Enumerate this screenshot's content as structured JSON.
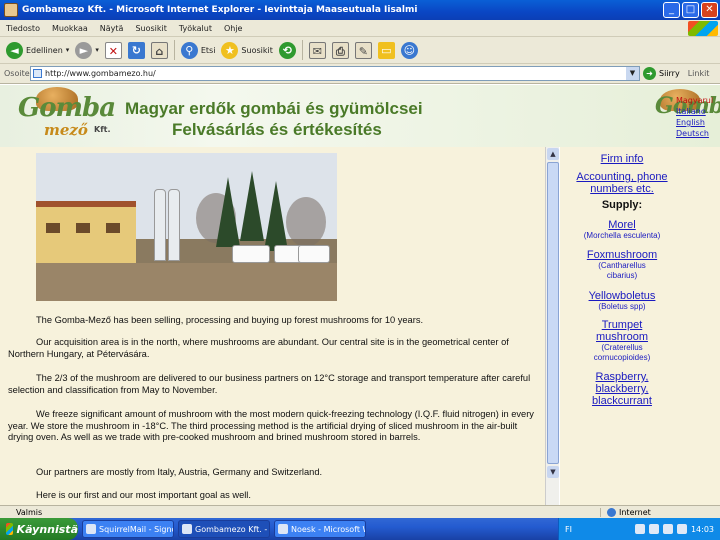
{
  "window": {
    "title": "Gombamezo Kft. - Microsoft Internet Explorer - Ievinttaja Maaseutuala Iisalmi"
  },
  "menu": [
    "Tiedosto",
    "Muokkaa",
    "Näytä",
    "Suosikit",
    "Työkalut",
    "Ohje"
  ],
  "toolbar": {
    "back_label": "Edellinen",
    "search_label": "Etsi",
    "favorites_label": "Suosikit"
  },
  "address": {
    "label": "Osoite",
    "url": "http://www.gombamezo.hu/",
    "go_label": "Siirry",
    "links_label": "Linkit"
  },
  "banner": {
    "logo_main": "Gomba",
    "logo_sub": "mező",
    "logo_kft": "Kft.",
    "title_line1": "Magyar erdők gombái és gyümölcsei",
    "title_line2": "Felvásárlás és értékesítés",
    "languages": [
      "Magyarul",
      "Italiano",
      "English",
      "Deutsch"
    ]
  },
  "content": {
    "paragraphs": [
      "The Gomba-Mező has been selling, processing and buying up forest mushrooms for 10 years.",
      "Our acquisition area is in the north, where mushrooms are abundant. Our central site is in the geometrical center of Northern Hungary, at Pétervására.",
      "The 2/3 of the mushroom are delivered to our business partners on 12°C storage and transport temperature after careful selection and classification from May to November.",
      "We freeze significant amount of mushroom with the most modern quick-freezing technology (I.Q.F. fluid nitrogen) in every year. We store the mushroom in -18°C. The third processing method is the artificial drying of sliced mushroom in the air-built drying oven. As well as we trade with pre-cooked mushroom and brined mushroom stored in barrels.",
      "Our partners are mostly from Italy, Austria, Germany and Switzerland.",
      "Here is our first and our most important goal as well."
    ]
  },
  "sidebar": {
    "firm_info": "Firm info",
    "accounting_line1": "Accounting, phone",
    "accounting_line2": "numbers etc.",
    "supply_heading": "Supply:",
    "morel": "Morel",
    "morel_latin": "(Morchella esculenta)",
    "foxmushroom": "Foxmushroom",
    "fox_latin_1": "(Cantharellus",
    "fox_latin_2": "cibarius)",
    "yellowboletus": "Yellowboletus",
    "boletus_latin": "(Boletus spp)",
    "trumpet_1": "Trumpet",
    "trumpet_2": "mushroom",
    "trumpet_latin_1": "(Craterellus",
    "trumpet_latin_2": "cornucopioides)",
    "rasp_1": "Raspberry,",
    "rasp_2": "blackberry,",
    "rasp_3": "blackcurrant"
  },
  "status": {
    "left": "Valmis",
    "zone": "Internet"
  },
  "taskbar": {
    "start_label": "Käynnistä",
    "tasks": [
      "SquirrelMail - Signout...",
      "Gombamezo Kft. - Mic...",
      "Noesk - Microsoft Word"
    ],
    "tray_lang": "FI",
    "clock": "14:03"
  }
}
